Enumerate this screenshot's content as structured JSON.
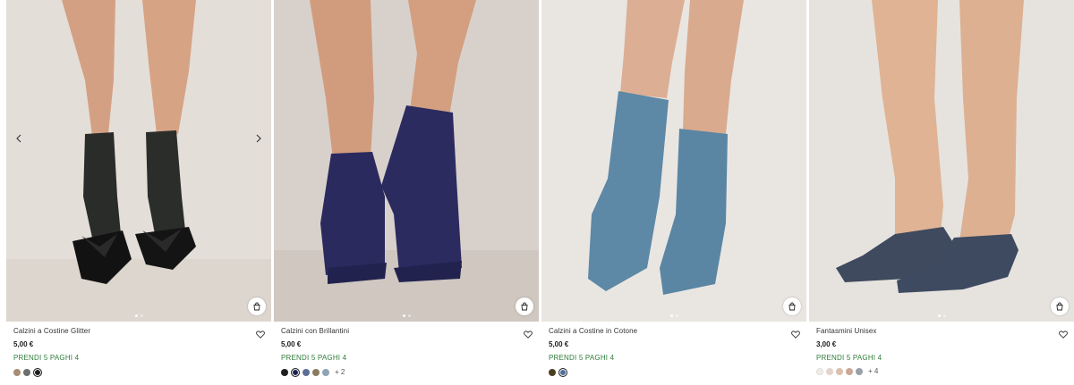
{
  "products": [
    {
      "name": "Calzini a Costine Glitter",
      "price": "5,00 €",
      "promo": "PRENDI 5 PAGHI 4",
      "swatches": [
        "#a88c74",
        "#6e6e6e",
        "#1c1c1c"
      ],
      "selected_swatch": 2,
      "more": "",
      "icons": {
        "wishlist": "heart-outline-icon",
        "quick_add": "shopping-bag-icon",
        "prev": "chevron-left-icon",
        "next": "chevron-right-icon"
      }
    },
    {
      "name": "Calzini con Brillantini",
      "price": "5,00 €",
      "promo": "PRENDI 5 PAGHI 4",
      "swatches": [
        "#1e1e1e",
        "#1d2350",
        "#5b6e95",
        "#8a7a5f",
        "#8ea3b4"
      ],
      "selected_swatch": 1,
      "more": "+ 2",
      "icons": {
        "wishlist": "heart-outline-icon",
        "quick_add": "shopping-bag-icon"
      }
    },
    {
      "name": "Calzini a Costine in Cotone",
      "price": "5,00 €",
      "promo": "PRENDI 5 PAGHI 4",
      "swatches": [
        "#4b3f21",
        "#4d6f9a"
      ],
      "selected_swatch": 1,
      "more": "",
      "icons": {
        "wishlist": "heart-outline-icon",
        "quick_add": "shopping-bag-icon"
      }
    },
    {
      "name": "Fantasmini Unisex",
      "price": "3,00 €",
      "promo": "PRENDI 5 PAGHI 4",
      "swatches": [
        "#f2ece6",
        "#e3d5cd",
        "#dcc0ae",
        "#c9a896",
        "#9aa0a8"
      ],
      "selected_swatch": -1,
      "more": "+ 4",
      "icons": {
        "wishlist": "heart-outline-icon",
        "quick_add": "shopping-bag-icon"
      }
    }
  ],
  "colors": {
    "promo_green": "#2f7d3b",
    "photo_bg_1": "#e4ded8",
    "photo_bg_2": "#d8d1cb",
    "photo_bg_3": "#e9e6e2",
    "photo_bg_4": "#e6e3df",
    "skin": "#d6a182",
    "sock_black_glitter": "#2a2c2a",
    "sock_navy": "#2a2a5e",
    "sock_blue": "#5d88a6",
    "sock_charcoal": "#3f4a5e"
  }
}
